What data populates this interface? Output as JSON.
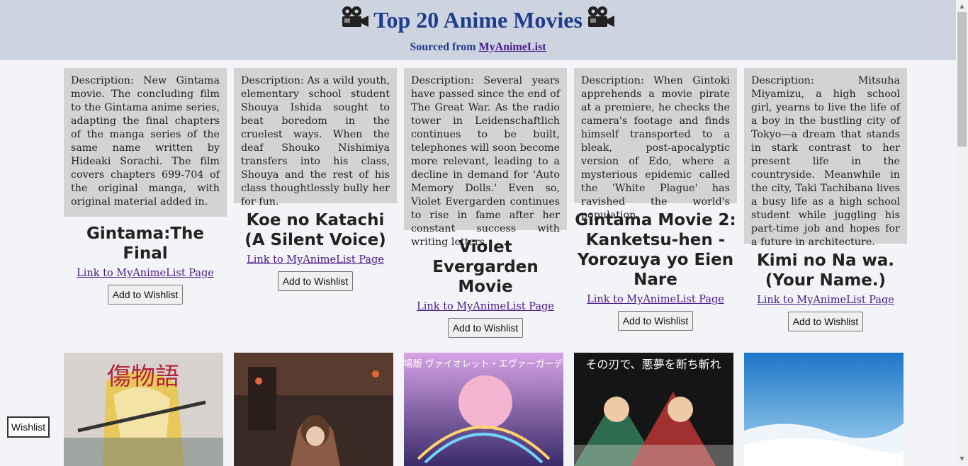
{
  "header": {
    "title": "Top 20 Anime Movies",
    "subtitle_prefix": "Sourced from",
    "source_link": "MyAnimeList"
  },
  "movies": [
    {
      "description": "Description: New Gintama movie. The concluding film to the Gintama anime series, adapting the final chapters of the manga series of the same name written by Hideaki Sorachi. The film covers chapters 699-704 of the original manga, with original material added in.",
      "title": "Gintama:The Final",
      "link": "Link to MyAnimeList Page",
      "button": "Add to Wishlist"
    },
    {
      "description": "Description: As a wild youth, elementary school student Shouya Ishida sought to beat boredom in the cruelest ways. When the deaf Shouko Nishimiya transfers into his class, Shouya and the rest of his class thoughtlessly bully her for fun.",
      "title": "Koe no Katachi (A Silent Voice)",
      "link": "Link to MyAnimeList Page",
      "button": "Add to Wishlist"
    },
    {
      "description": "Description: Several years have passed since the end of The Great War. As the radio tower in Leidenschaftlich continues to be built, telephones will soon become more relevant, leading to a decline in demand for 'Auto Memory Dolls.' Even so, Violet Evergarden continues to rise in fame after her constant success with writing letters.",
      "title": "Violet Evergarden Movie",
      "link": "Link to MyAnimeList Page",
      "button": "Add to Wishlist"
    },
    {
      "description": "Description: When Gintoki apprehends a movie pirate at a premiere, he checks the camera's footage and finds himself transported to a bleak, post-apocalyptic version of Edo, where a mysterious epidemic called the 'White Plague' has ravished the world's population.",
      "title": "Gintama Movie 2: Kanketsu-hen - Yorozuya yo Eien Nare",
      "link": "Link to MyAnimeList Page",
      "button": "Add to Wishlist"
    },
    {
      "description": "Description: Mitsuha Miyamizu, a high school girl, yearns to live the life of a boy in the bustling city of Tokyo—a dream that stands in stark contrast to her present life in the countryside. Meanwhile in the city, Taki Tachibana lives a busy life as a high school student while juggling his part-time job and hopes for a future in architecture.",
      "title": "Kimi no Na wa. (Your Name.)",
      "link": "Link to MyAnimeList Page",
      "button": "Add to Wishlist"
    }
  ],
  "posters": [
    {
      "text": "傷物語"
    },
    {
      "text": ""
    },
    {
      "text": "劇場版 ヴァイオレット・エヴァーガーデン"
    },
    {
      "text": "その刃で、悪夢を断ち斬れ"
    },
    {
      "text": ""
    }
  ],
  "wishlist_button": "Wishlist"
}
